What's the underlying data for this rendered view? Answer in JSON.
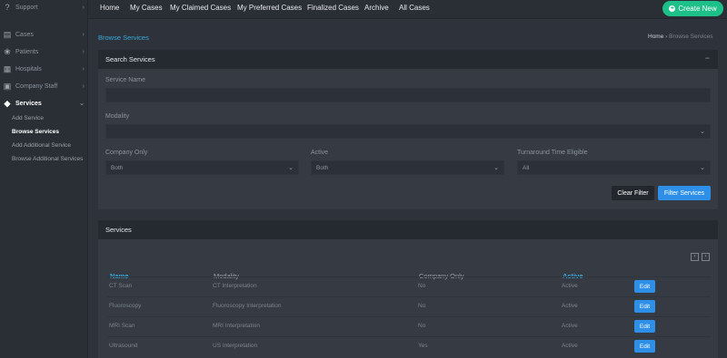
{
  "sidebar": {
    "support": "Support",
    "items": [
      {
        "label": "Cases",
        "icon": "clipboard-icon"
      },
      {
        "label": "Patients",
        "icon": "paw-icon"
      },
      {
        "label": "Hospitals",
        "icon": "building-icon"
      },
      {
        "label": "Company Staff",
        "icon": "id-card-icon"
      },
      {
        "label": "Services",
        "icon": "tags-icon"
      }
    ],
    "sub_items": [
      "Add Service",
      "Browse Services",
      "Add Additional Service",
      "Browse Additional Services"
    ]
  },
  "nav": {
    "links": [
      "Home",
      "My Cases",
      "My Claimed Cases",
      "My Preferred Cases",
      "Finalized Cases",
      "Archive",
      "All Cases"
    ],
    "create_label": "Create New"
  },
  "page": {
    "title": "Browse Services",
    "breadcrumb_home": "Home",
    "breadcrumb_sep": "›",
    "breadcrumb_current": "Browse Services"
  },
  "search": {
    "title": "Search Services",
    "collapse": "−",
    "service_name_label": "Service Name",
    "service_name_value": "",
    "modality_label": "Modality",
    "modality_value": "",
    "company_only_label": "Company Only",
    "company_only_value": "Both",
    "active_label": "Active",
    "active_value": "Both",
    "turnaround_label": "Turnaround Time Eligible",
    "turnaround_value": "All",
    "clear_label": "Clear Filter",
    "filter_label": "Filter Services"
  },
  "services": {
    "title": "Services",
    "prev": "‹",
    "next": "›",
    "headers": [
      "Name",
      "Modality",
      "Company Only",
      "Active"
    ],
    "rows": [
      {
        "name": "CT Scan",
        "modality": "CT Interpretation",
        "company_only": "No",
        "active": "Active",
        "edit": "Edit"
      },
      {
        "name": "Fluoroscopy",
        "modality": "Fluoroscopy Interpretation",
        "company_only": "No",
        "active": "Active",
        "edit": "Edit"
      },
      {
        "name": "MRI Scan",
        "modality": "MRI Interpretation",
        "company_only": "No",
        "active": "Active",
        "edit": "Edit"
      },
      {
        "name": "Ultrasound",
        "modality": "US Interpretation",
        "company_only": "Yes",
        "active": "Active",
        "edit": "Edit"
      }
    ]
  },
  "colors": {
    "accent": "#39a8d8",
    "create_button": "#1ec08a",
    "primary_button": "#2e8fe8"
  }
}
